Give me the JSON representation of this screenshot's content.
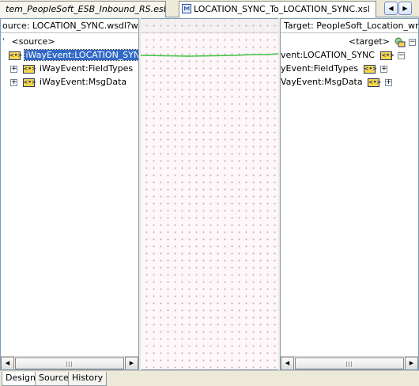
{
  "tabs": {
    "esb_file": "tem_PeopleSoft_ESB_Inbound_RS.esbsvc",
    "xsl_file": "LOCATION_SYNC_To_LOCATION_SYNC.xsl",
    "xsl_icon": "xsl-file-icon",
    "nav_left": "◀",
    "nav_right": "▶"
  },
  "source_panel": {
    "title": "ource: LOCATION_SYNC.wsdl?wsdl",
    "root_marker": "'",
    "root_label": "<source>",
    "nodes": [
      {
        "label": "iWayEvent:LOCATION_SYNC",
        "selected": true
      },
      {
        "label": "iWayEvent:FieldTypes",
        "expander": "+"
      },
      {
        "label": "iWayEvent:MsgData",
        "expander": "+"
      }
    ],
    "node_icon": "<•>"
  },
  "target_panel": {
    "title": "Target: PeopleSoft_Location_write",
    "root_label": "<target>",
    "nodes": [
      {
        "label": "vent:LOCATION_SYNC",
        "expander": "−"
      },
      {
        "label": "yEvent:FieldTypes",
        "expander": "+"
      },
      {
        "label": "VayEvent:MsgData",
        "expander": "+"
      }
    ],
    "node_icon": "<•>"
  },
  "mapping": {
    "line_color": "#3cc43c"
  },
  "scrollbar": {
    "left_arrow": "◀",
    "right_arrow": "▶"
  },
  "bottom_tabs": [
    "Design",
    "Source",
    "History"
  ],
  "colors": {
    "selection": "#3169c6",
    "node_icon_fill": "#f7d64a",
    "canvas_bg": "#fff6f9"
  }
}
